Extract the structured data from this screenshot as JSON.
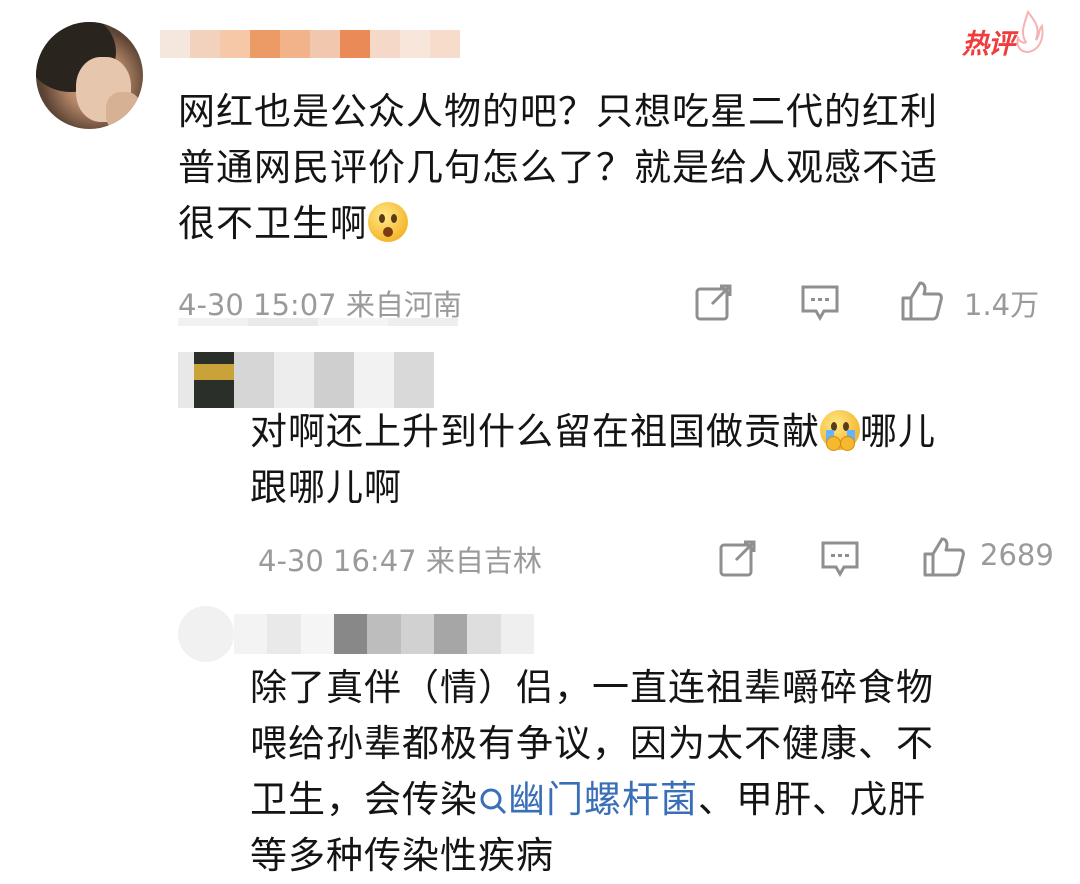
{
  "badge": {
    "label": "热评"
  },
  "comments": [
    {
      "lines": [
        "网红也是公众人物的吧？只想吃星二代的红利",
        "普通网民评价几句怎么了？就是给人观感不适",
        "很不卫生啊"
      ],
      "emoji": "thinking-face-emoji",
      "meta": "4-30 15:07 来自河南",
      "likes": "1.4万"
    },
    {
      "lines_part1": "对啊还上升到什么留在祖国做贡献",
      "lines_part2": "哪儿",
      "lines_line2": "跟哪儿啊",
      "emoji": "crying-face-emoji",
      "meta": "4-30 16:47 来自吉林",
      "likes": "2689"
    },
    {
      "line1": "除了真伴（情）侣，一直连祖辈嚼碎食物",
      "line2": "喂给孙辈都极有争议，因为太不健康、不",
      "line3_before": "卫生，会传染",
      "line3_link": "幽门螺杆菌",
      "line3_after": "、甲肝、戊肝",
      "line4": "等多种传染性疾病"
    }
  ],
  "colors": {
    "badge_red": "#ef3c3c",
    "meta_gray": "#9a9a9a",
    "link_blue": "#3a6fb7"
  }
}
